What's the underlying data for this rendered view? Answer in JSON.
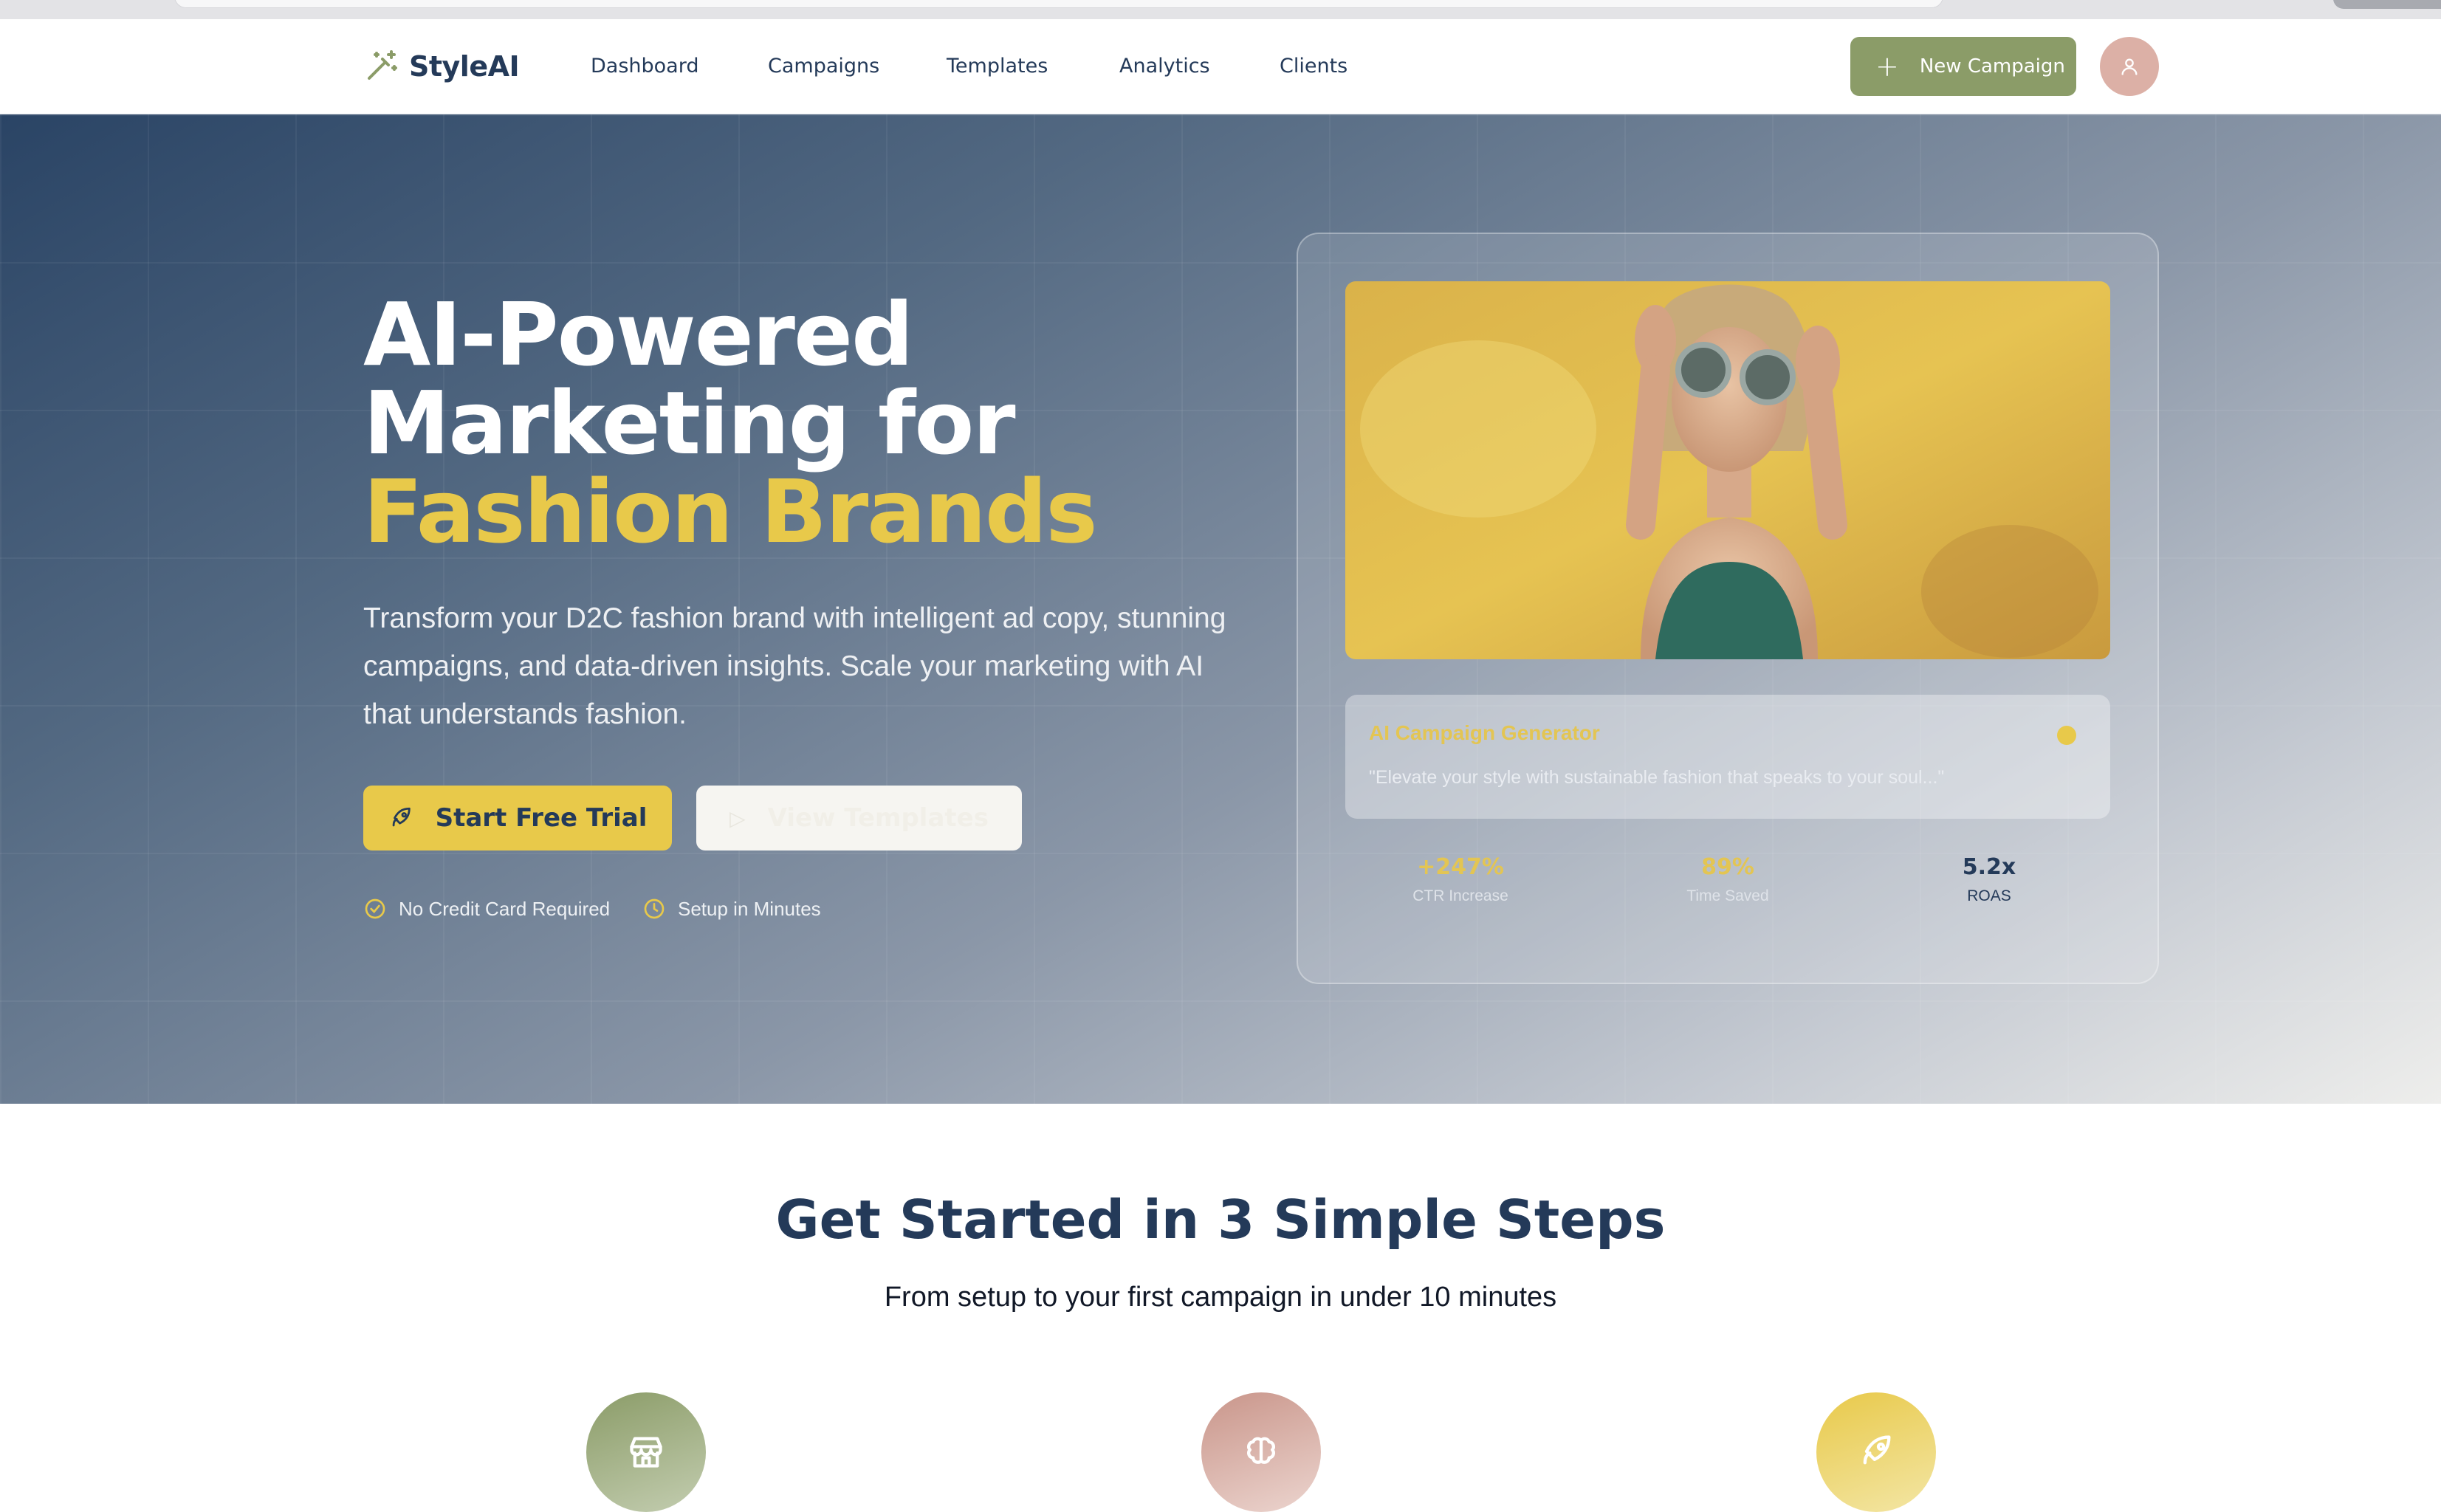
{
  "brand": {
    "name": "StyleAI",
    "logo_icon": "magic-wand-icon"
  },
  "nav": {
    "links": [
      "Dashboard",
      "Campaigns",
      "Templates",
      "Analytics",
      "Clients"
    ],
    "new_campaign_label": "New Campaign",
    "accent_color": "#8b9c68"
  },
  "hero": {
    "title_line1": "AI-Powered",
    "title_line2": "Marketing for",
    "title_line3": "Fashion Brands",
    "subtitle": "Transform your D2C fashion brand with intelligent ad copy, stunning campaigns, and data-driven insights. Scale your marketing with AI that understands fashion.",
    "primary_cta": "Start Free Trial",
    "secondary_cta": "View Templates",
    "perks": [
      "No Credit Card Required",
      "Setup in Minutes"
    ],
    "accent_color": "#e8c94a"
  },
  "preview_card": {
    "generator_title": "AI Campaign Generator",
    "generator_quote": "\"Elevate your style with sustainable fashion that speaks to your soul...\"",
    "stats": [
      {
        "value": "+247%",
        "label": "CTR Increase"
      },
      {
        "value": "89%",
        "label": "Time Saved"
      },
      {
        "value": "5.2x",
        "label": "ROAS"
      }
    ]
  },
  "steps": {
    "title": "Get Started in 3 Simple Steps",
    "subtitle": "From setup to your first campaign in under 10 minutes",
    "icons": [
      "store-icon",
      "brain-icon",
      "rocket-icon"
    ]
  }
}
